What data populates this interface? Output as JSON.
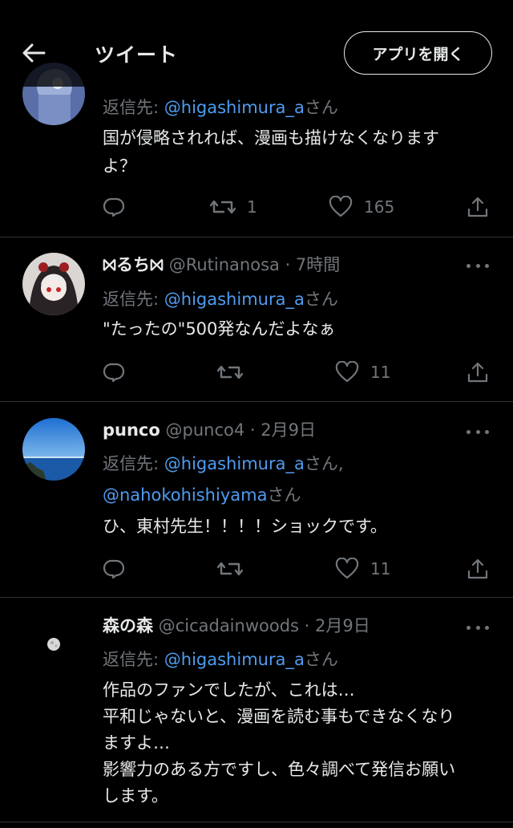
{
  "header": {
    "title": "ツイート",
    "open_app_label": "アプリを開く"
  },
  "tweets": [
    {
      "reply_prefix": "返信先: ",
      "reply_handle": "@higashimura_a",
      "reply_suffix": "さん",
      "body_lines": [
        "国が侵略されれば、漫画も描けなくなります",
        "よ？"
      ],
      "retweets": "1",
      "likes": "165"
    },
    {
      "name": "⨝るち⨝",
      "handle": "@Rutinanosa",
      "time": "· 7時間",
      "reply_prefix": "返信先: ",
      "reply_handle": "@higashimura_a",
      "reply_suffix": "さん",
      "body_lines": [
        "\"たったの\"500発なんだよなぁ"
      ],
      "likes": "11"
    },
    {
      "name": "punco",
      "handle": "@punco4",
      "time": "· 2月9日",
      "reply_prefix": "返信先: ",
      "reply_handle": "@higashimura_a",
      "reply_suffix": "さん,",
      "reply_handle_2": "@nahokohishiyama",
      "reply_suffix_2": "さん",
      "body_lines": [
        "ひ、東村先生！！！！ショックです。"
      ],
      "likes": "11"
    },
    {
      "name": "森の森",
      "handle": "@cicadainwoods",
      "time": "· 2月9日",
      "reply_prefix": "返信先: ",
      "reply_handle": "@higashimura_a",
      "reply_suffix": "さん",
      "body_lines": [
        "作品のファンでしたが、これは…",
        "平和じゃないと、漫画を読む事もできなくなり",
        "ますよ…",
        "影響力のある方ですし、色々調べて発信お願い",
        "します。"
      ]
    }
  ],
  "icons": {
    "back": "arrow-left-icon",
    "reply": "reply-icon",
    "retweet": "retweet-icon",
    "like": "heart-icon",
    "share": "share-icon",
    "more": "more-icon"
  },
  "colors": {
    "background": "#000000",
    "text": "#e7e9ea",
    "muted": "#71767b",
    "link": "#4f9cf0",
    "divider": "#2f3336"
  }
}
